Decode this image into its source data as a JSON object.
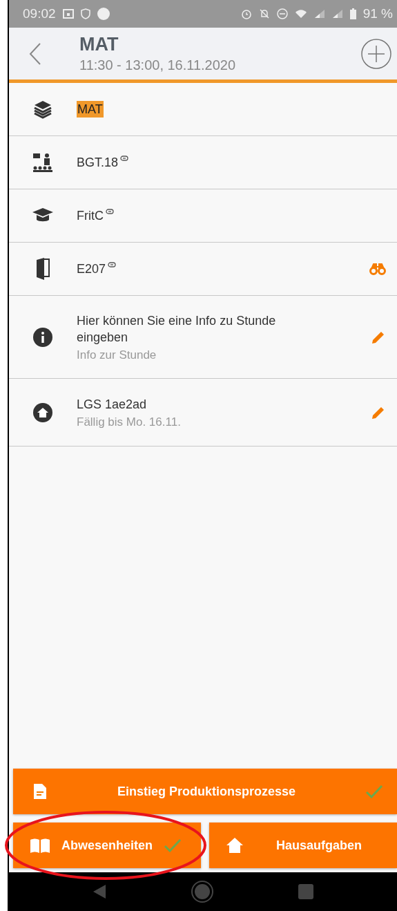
{
  "status_bar": {
    "time": "09:02",
    "battery": "91 %"
  },
  "header": {
    "title": "MAT",
    "subtitle": "11:30 - 13:00, 16.11.2020"
  },
  "rows": [
    {
      "kind": "subject",
      "text": "MAT",
      "highlighted": true,
      "linked": false
    },
    {
      "kind": "class",
      "text": "BGT.18",
      "highlighted": false,
      "linked": true
    },
    {
      "kind": "teacher",
      "text": "FritC",
      "highlighted": false,
      "linked": true
    },
    {
      "kind": "room",
      "text": "E207",
      "highlighted": false,
      "linked": true,
      "searchable": true
    },
    {
      "kind": "info",
      "text": "Hier können Sie eine Info zu Stunde eingeben",
      "subtitle": "Info zur Stunde",
      "highlighted": false,
      "linked": false,
      "editable": true
    },
    {
      "kind": "homework",
      "text": "LGS 1ae2ad",
      "subtitle": "Fällig bis Mo. 16.11.",
      "highlighted": false,
      "linked": false,
      "editable": true
    }
  ],
  "buttons": [
    {
      "kind": "document",
      "label": "Einstieg Produktionsprozesse",
      "checked": true,
      "circled": false
    },
    {
      "kind": "book",
      "label": "Abwesenheiten",
      "checked": true,
      "circled": true
    },
    {
      "kind": "home",
      "label": "Hausaufgaben",
      "checked": false,
      "circled": false
    }
  ]
}
